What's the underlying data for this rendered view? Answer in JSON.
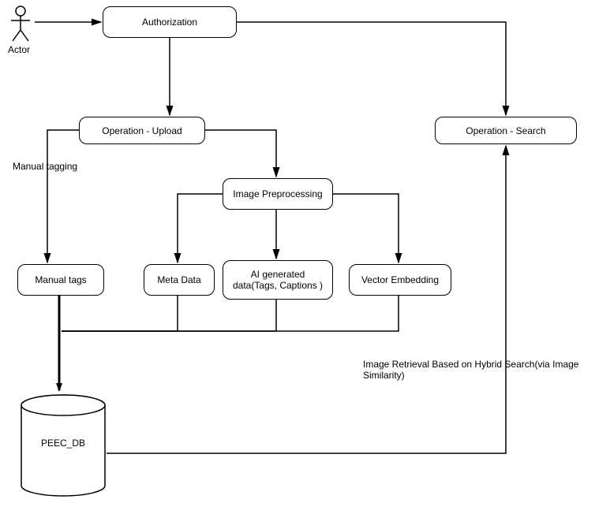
{
  "actor_label": "Actor",
  "nodes": {
    "authorization": "Authorization",
    "operation_upload": "Operation - Upload",
    "operation_search": "Operation - Search",
    "image_preprocessing": "Image Preprocessing",
    "manual_tags": "Manual tags",
    "meta_data": "Meta Data",
    "ai_generated": "AI generated data(Tags, Captions )",
    "vector_embedding": "Vector Embedding",
    "db": "PEEC_DB"
  },
  "edge_labels": {
    "manual_tagging": "Manual tagging",
    "hybrid_search": "Image Retrieval Based on Hybrid Search(via Image Similarity)"
  }
}
